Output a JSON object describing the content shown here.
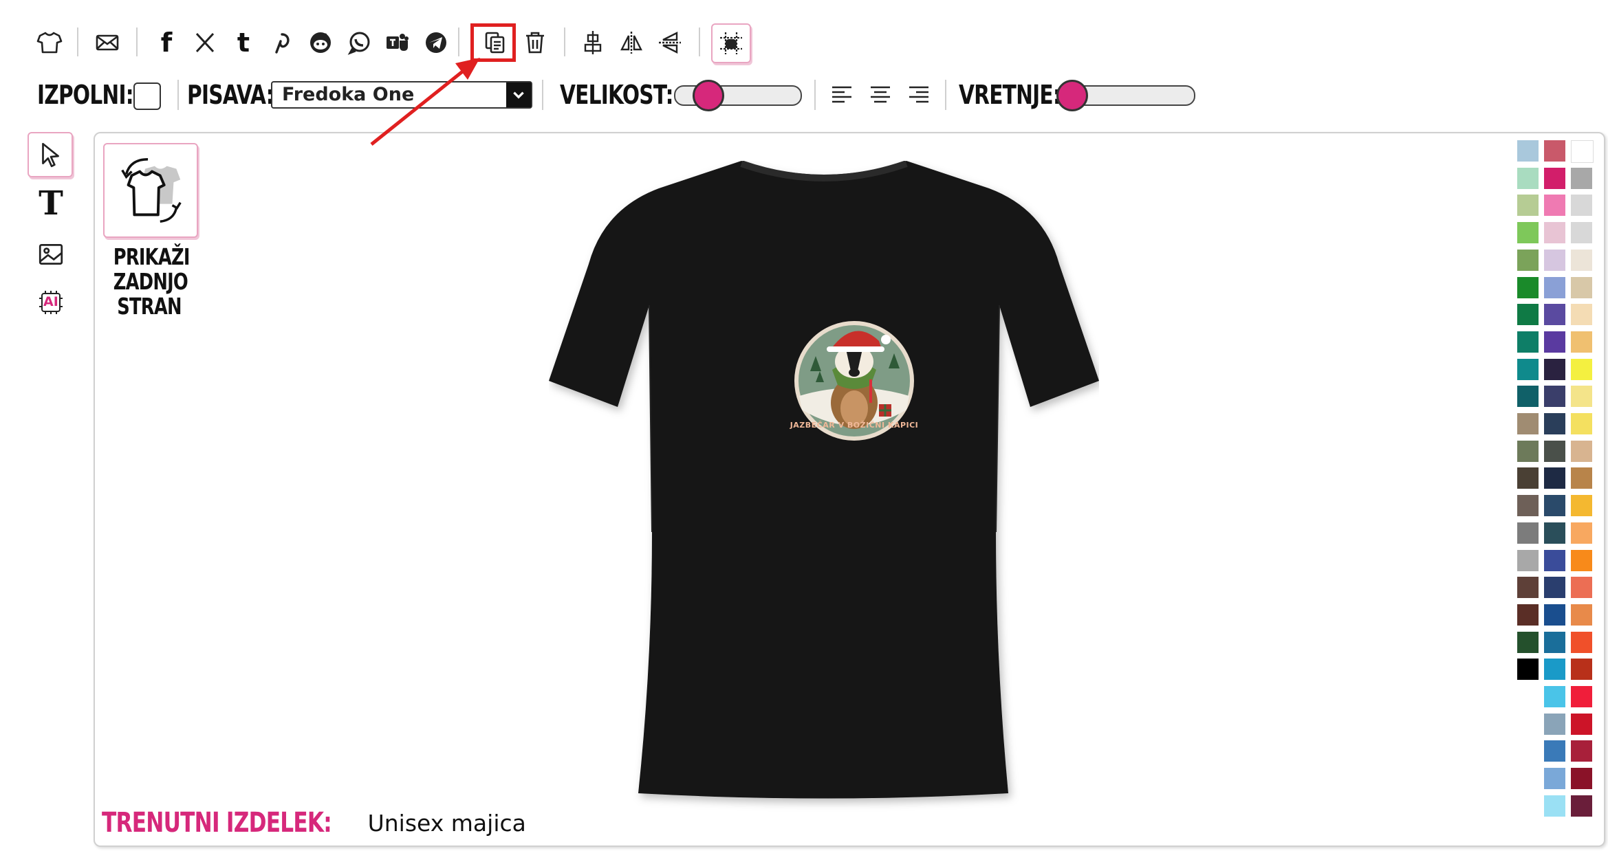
{
  "toolbar": {
    "icons": [
      "shirt-icon",
      "mail-icon",
      "facebook-icon",
      "x-icon",
      "tumblr-icon",
      "pinterest-icon",
      "reddit-icon",
      "whatsapp-icon",
      "teams-icon",
      "telegram-icon",
      "duplicate-icon",
      "trash-icon",
      "align-center-icon",
      "flip-horizontal-icon",
      "flip-vertical-icon",
      "grid-icon"
    ],
    "facebook_glyph": "f",
    "x_glyph": "𝕏",
    "tumblr_glyph": "t"
  },
  "props": {
    "fill_label": "IZPOLNI:",
    "font_label": "PISAVA:",
    "font_value": "Fredoka One",
    "size_label": "VELIKOST:",
    "size_level": 0.2,
    "rotate_label": "VRETNJE:",
    "rotate_level": 0.0
  },
  "tools": [
    "select-tool",
    "text-tool",
    "image-tool",
    "ai-tool"
  ],
  "text_tool_glyph": "T",
  "ai_tool_glyph": "AI",
  "back_view": {
    "label_line1": "PRIKAŽI",
    "label_line2": "ZADNJO",
    "label_line3": "STRAN"
  },
  "design": {
    "caption": "JAZBEČAR V BOŽIČNI KAPICI"
  },
  "product": {
    "label": "TRENUTNI IZDELEK:",
    "value": "Unisex majica"
  },
  "colors": {
    "accent": "#d6287b",
    "annotation": "#e02020",
    "shirt": "#121212"
  },
  "palette": {
    "col1": [
      "#a9c8dc",
      "#a9dcc0",
      "#b6cc94",
      "#7ec85a",
      "#7ba35a",
      "#1a8a2a",
      "#0f7a45",
      "#0e7e67",
      "#0f8a8c",
      "#106068",
      "#a08c72",
      "#6d7a5a",
      "#4a4034",
      "#6e6058",
      "#7c7c7c",
      "#a8a8a8",
      "#5e4038",
      "#5a2e26",
      "#24502c",
      "#000000"
    ],
    "col2": [
      "#c9596a",
      "#d21e6a",
      "#ef7ab2",
      "#e8c4d4",
      "#d6c6e0",
      "#8aa0d6",
      "#5a4aa0",
      "#5a3aa0",
      "#2a2240",
      "#3a3e6a",
      "#2a3e5a",
      "#4a504a",
      "#1e2a44",
      "#2a4a6a",
      "#2a4e5a",
      "#3a4c9a",
      "#2a3e6e",
      "#1a4e8e",
      "#1a6e9a",
      "#1a9ac8",
      "#4ac4e8",
      "#8aa4b8",
      "#3a7ab8",
      "#7aa8d8",
      "#9ae0f4"
    ],
    "col3": [
      "#ffffff",
      "#a8a8a8",
      "#d8d8d8",
      "#d8d8d8",
      "#ece4d8",
      "#d8c8a8",
      "#f4dcb4",
      "#f0c070",
      "#f4f040",
      "#f4e48a",
      "#f4e060",
      "#d8b490",
      "#b8844a",
      "#f4b830",
      "#f8a860",
      "#f88a1a",
      "#ec6e54",
      "#e88a4a",
      "#f0502a",
      "#b8301a",
      "#f01e3a",
      "#cc1428",
      "#a8203a",
      "#8a1228",
      "#6a1e3a"
    ]
  }
}
